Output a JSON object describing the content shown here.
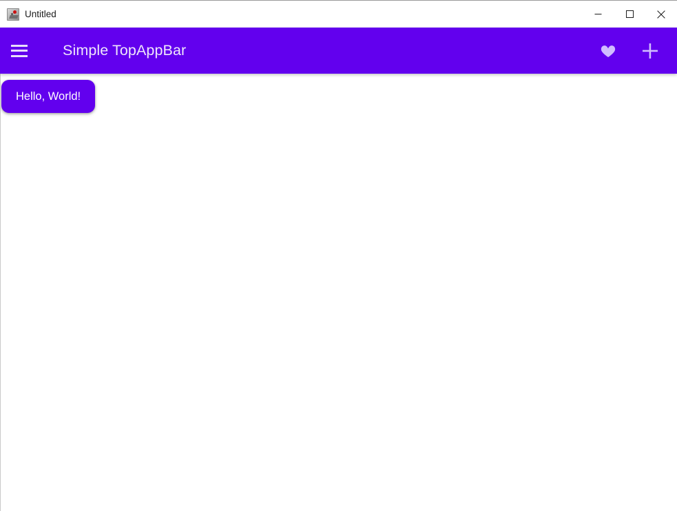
{
  "window": {
    "title": "Untitled",
    "icon": "python-app-icon",
    "controls": [
      {
        "name": "minimize-button",
        "glyph": "minimize-icon"
      },
      {
        "name": "maximize-button",
        "glyph": "maximize-icon"
      },
      {
        "name": "close-button",
        "glyph": "close-icon"
      }
    ]
  },
  "appbar": {
    "title": "Simple TopAppBar",
    "background_color": "#6200EE",
    "icon_color": "#D0BCFF",
    "nav_icon": "hamburger-menu-icon",
    "actions": [
      {
        "name": "favorite-button",
        "icon": "heart-icon"
      },
      {
        "name": "add-button",
        "icon": "plus-icon"
      }
    ]
  },
  "content": {
    "button_label": "Hello, World!",
    "button_color": "#6200EE",
    "button_text_color": "#FFFFFF",
    "background_color": "#FFFFFF"
  }
}
